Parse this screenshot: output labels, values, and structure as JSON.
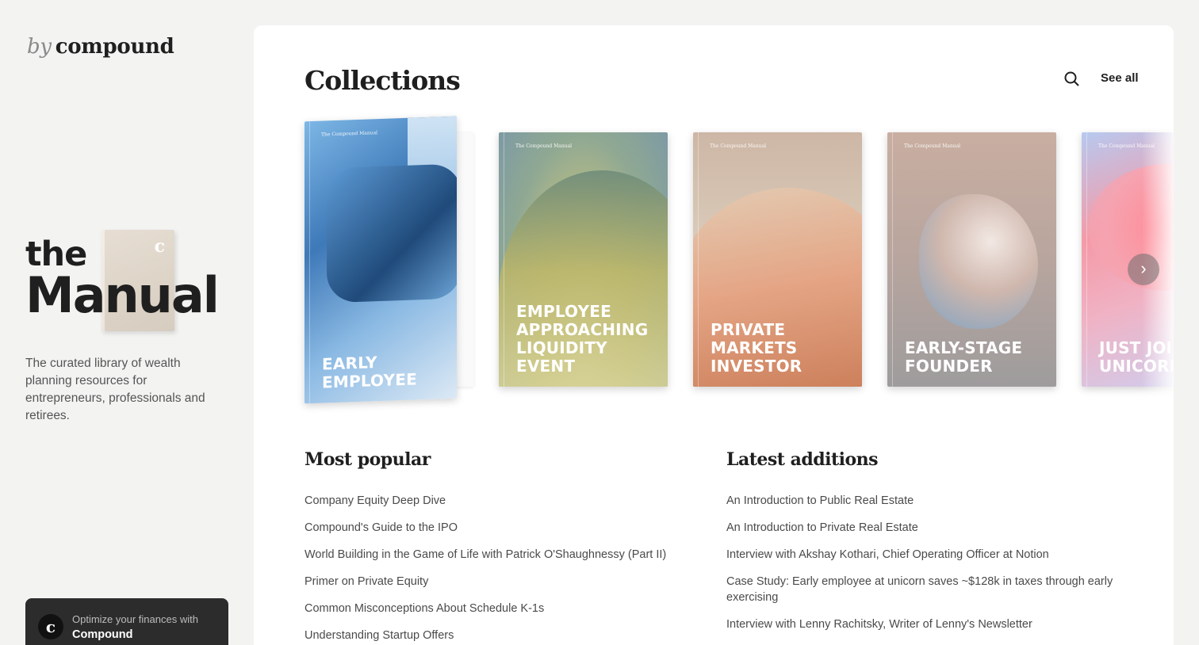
{
  "sidebar": {
    "brand_by": "by",
    "brand_name": "compound",
    "hero_the": "the",
    "hero_manual": "Manual",
    "hero_book_mark": "c",
    "tagline": "The curated library of wealth planning resources for entrepreneurs, professionals and retirees.",
    "promo": {
      "logo": "c",
      "line1": "Optimize your finances with",
      "line2": "Compound"
    }
  },
  "main": {
    "title": "Collections",
    "see_all": "See all",
    "search_icon": "search-icon",
    "next_icon": "chevron-right-icon",
    "books": [
      {
        "series": "The Compound Manual",
        "title": "Early Employee"
      },
      {
        "series": "The Compound Manual",
        "title": "Employee Approaching Liquidity Event"
      },
      {
        "series": "The Compound Manual",
        "title": "Private Markets Investor"
      },
      {
        "series": "The Compound Manual",
        "title": "Early-Stage Founder"
      },
      {
        "series": "The Compound Manual",
        "title": "Just Joined a Unicorn"
      }
    ],
    "most_popular": {
      "title": "Most popular",
      "items": [
        "Company Equity Deep Dive",
        "Compound's Guide to the IPO",
        "World Building in the Game of Life with Patrick O'Shaughnessy (Part II)",
        "Primer on Private Equity",
        "Common Misconceptions About Schedule K-1s",
        "Understanding Startup Offers"
      ]
    },
    "latest_additions": {
      "title": "Latest additions",
      "items": [
        "An Introduction to Public Real Estate",
        "An Introduction to Private Real Estate",
        "Interview with Akshay Kothari, Chief Operating Officer at Notion",
        "Case Study: Early employee at unicorn saves ~$128k in taxes through early exercising",
        "Interview with Lenny Rachitsky, Writer of Lenny's Newsletter"
      ]
    }
  }
}
